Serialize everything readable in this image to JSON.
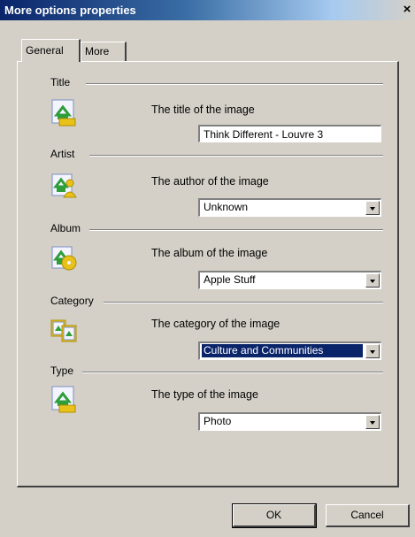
{
  "window": {
    "title": "More options properties",
    "close_glyph": "×"
  },
  "tabs": [
    {
      "label": "General",
      "active": true
    },
    {
      "label": "More",
      "active": false
    }
  ],
  "sections": [
    {
      "name": "Title",
      "prompt": "The title of the image",
      "control": "text",
      "value": "Think Different - Louvre 3",
      "icon": "title-image-icon"
    },
    {
      "name": "Artist",
      "prompt": "The author of the image",
      "control": "combo",
      "value": "Unknown",
      "icon": "artist-image-icon"
    },
    {
      "name": "Album",
      "prompt": "The album of the image",
      "control": "combo",
      "value": "Apple Stuff",
      "icon": "album-image-icon"
    },
    {
      "name": "Category",
      "prompt": "The category of the image",
      "control": "combo",
      "value": "Culture and Communities",
      "selected": true,
      "icon": "category-image-icon"
    },
    {
      "name": "Type",
      "prompt": "The type of the image",
      "control": "combo",
      "value": "Photo",
      "icon": "type-image-icon"
    }
  ],
  "buttons": {
    "ok": "OK",
    "cancel": "Cancel"
  },
  "colors": {
    "titlebar": "#0a246a",
    "face": "#d4d0c8",
    "selection": "#0a246a",
    "icon_green": "#2e9e3a",
    "icon_yellow": "#e8c21a"
  }
}
